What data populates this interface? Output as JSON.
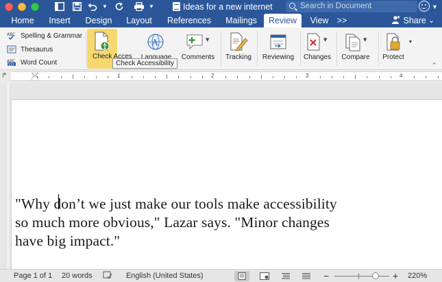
{
  "window": {
    "title": "Ideas for a new internet",
    "search_placeholder": "Search in Document"
  },
  "tabs": [
    {
      "label": "Home"
    },
    {
      "label": "Insert"
    },
    {
      "label": "Design"
    },
    {
      "label": "Layout"
    },
    {
      "label": "References"
    },
    {
      "label": "Mailings"
    },
    {
      "label": "Review",
      "active": true
    },
    {
      "label": "View"
    }
  ],
  "tabs_overflow": ">>",
  "share_label": "Share",
  "ribbon": {
    "proofing": [
      "Spelling & Grammar",
      "Thesaurus",
      "Word Count"
    ],
    "check_accessibility": "Check Acces",
    "language": "Language",
    "comments": "Comments",
    "tracking": "Tracking",
    "reviewing": "Reviewing",
    "changes": "Changes",
    "compare": "Compare",
    "protect": "Protect"
  },
  "tooltip": "Check Accessibility",
  "ruler_numbers": [
    "1",
    "2",
    "3",
    "4"
  ],
  "document": {
    "text": "\"Why don’t we just make our tools make accessibility\nso much more obvious,\" Lazar says. \"Minor changes\nhave big impact.\""
  },
  "status": {
    "page": "Page 1 of 1",
    "words": "20 words",
    "language": "English (United States)",
    "zoom_minus": "−",
    "zoom_plus": "+",
    "zoom": "220%",
    "zoom_level": 220
  },
  "colors": {
    "title_bar": "#2b579a",
    "highlight": "#f6d86e"
  }
}
